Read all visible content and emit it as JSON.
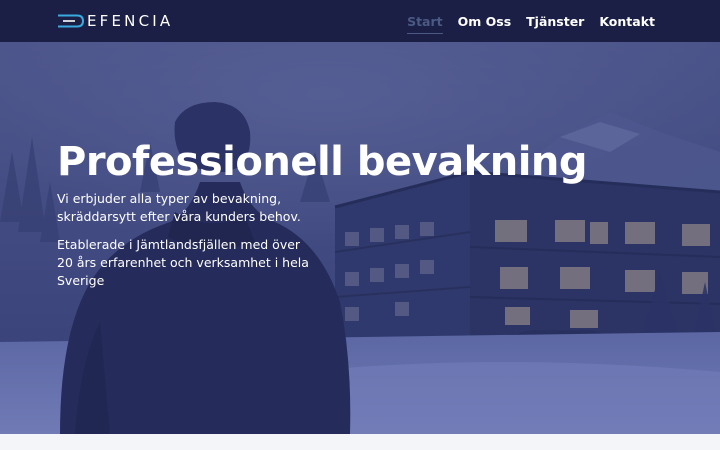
{
  "brand": {
    "logo_text": "EFENCIA",
    "logo_icon": "stylized-d-lines-icon",
    "accent_color": "#3aa9e0",
    "header_color": "#1b1f45"
  },
  "nav": {
    "items": [
      {
        "label": "Start",
        "active": true
      },
      {
        "label": "Om Oss",
        "active": false
      },
      {
        "label": "Tjänster",
        "active": false
      },
      {
        "label": "Kontakt",
        "active": false
      }
    ]
  },
  "hero": {
    "title": "Professionell bevakning",
    "paragraphs": [
      "Vi erbjuder alla typer av bevakning, skräddarsytt efter våra kunders behov.",
      "Etablerade i Jämtlandsfjällen med över 20 års erfarenhet och verksamhet i hela Sverige"
    ],
    "overlay_color": "#263078"
  }
}
